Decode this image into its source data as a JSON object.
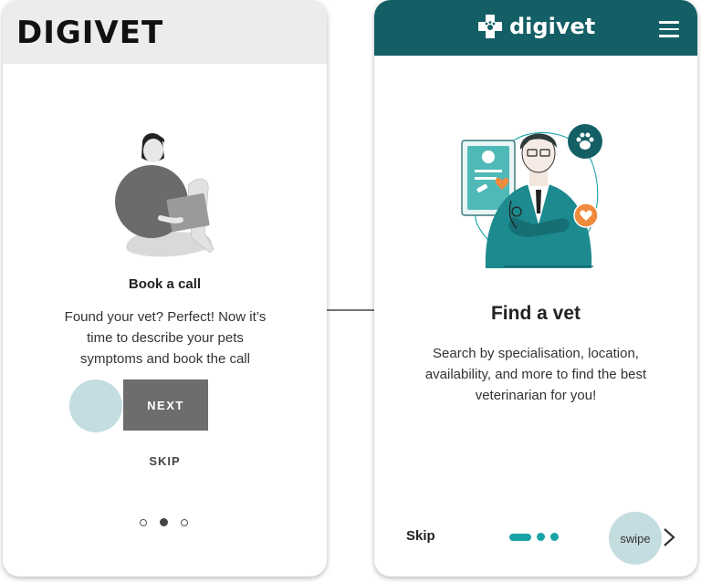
{
  "left": {
    "brand": "DIGIVET",
    "title": "Book a call",
    "body": "Found your vet? Perfect! Now it’s time to describe your pets symptoms and book the call",
    "next_label": "NEXT",
    "skip_label": "SKIP",
    "pager": {
      "count": 3,
      "active": 2
    }
  },
  "right": {
    "brand": "digivet",
    "title": "Find a vet",
    "body": "Search by specialisation, location, availability, and more to find the best veterinarian for you!",
    "skip_label": "Skip",
    "swipe_label": "swipe",
    "colors": {
      "header": "#145f66",
      "accent": "#19a3a6",
      "circle": "#c3dde0",
      "heart": "#f08a3c"
    }
  }
}
